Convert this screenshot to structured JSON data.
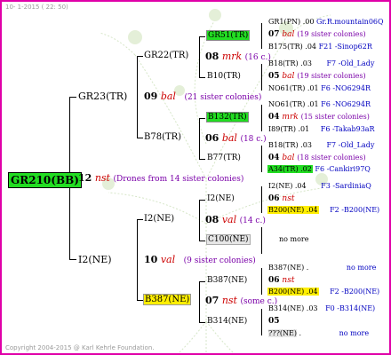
{
  "header": "10-  1-2015 ( 22: 50)",
  "footer": "Copyright 2004-2015 @ Karl Kehrle Foundation.",
  "root": {
    "name": "GR210(BB)",
    "gen": "12",
    "mark": "nst",
    "info": "(Drones from 14 sister colonies)"
  },
  "g1": {
    "top": {
      "name": "GR23(TR)",
      "gen": "09",
      "mark": "bal",
      "info": "(21 sister colonies)"
    },
    "bottom": {
      "name": "I2(NE)",
      "gen": "10",
      "mark": "val",
      "info": "(9 sister colonies)"
    }
  },
  "g2": {
    "a": {
      "name": "GR22(TR)",
      "gen": "08",
      "mark": "mrk",
      "info": "(16 c.)"
    },
    "b": {
      "name": "B78(TR)",
      "gen": "06",
      "mark": "bal",
      "info": "(18 c.)"
    },
    "c": {
      "name": "I2(NE)",
      "gen": "08",
      "mark": "val",
      "info": "(14 c.)"
    },
    "d": {
      "name": "B387(NE)",
      "gen": "07",
      "mark": "nst",
      "info": "(some c.)"
    }
  },
  "g3": {
    "a1": "GR51(TR)",
    "a2": "B10(TR)",
    "b1": "B132(TR)",
    "b2": "B77(TR)",
    "c1": "I2(NE)",
    "c2": "C100(NE)",
    "d1": "B387(NE)",
    "d2": "B314(NE)"
  },
  "g4": {
    "r1": {
      "name": "GR1(PN)",
      "extra": ".00",
      "label": "Gr.R.mountain06Q"
    },
    "r2": {
      "gen": "07",
      "mark": "bal",
      "info": "(19 sister colonies)"
    },
    "r3": {
      "name": "B175(TR)",
      "extra": ".04",
      "label": "F21 -Sinop62R"
    },
    "r4": {
      "name": "B18(TR)",
      "extra": ".03",
      "label": "F7 -Old_Lady"
    },
    "r5": {
      "gen": "05",
      "mark": "bal",
      "info": "(19 sister colonies)"
    },
    "r6": {
      "name": "NO61(TR)",
      "extra": ".01",
      "label": "F6 -NO6294R"
    },
    "r7": {
      "name": "NO61(TR)",
      "extra": ".01",
      "label": "F6 -NO6294R"
    },
    "r8": {
      "gen": "04",
      "mark": "mrk",
      "info": "(15 sister colonies)"
    },
    "r9": {
      "name": "I89(TR)",
      "extra": ".01",
      "label": "F6 -Takab93aR"
    },
    "r10": {
      "name": "B18(TR)",
      "extra": ".03",
      "label": "F7 -Old_Lady"
    },
    "r11": {
      "gen": "04",
      "mark": "bal",
      "info": "(18 sister colonies)"
    },
    "r12": {
      "name": "A34(TR)",
      "extra": ".02",
      "label": "F6 -Cankiri97Q"
    },
    "r13": {
      "name": "I2(NE)",
      "extra": ".04",
      "label": "F3 -SardiniaQ"
    },
    "r14": {
      "gen": "06",
      "mark": "nst"
    },
    "r15": {
      "name": "B200(NE)",
      "extra": ".04",
      "label": "F2 -B200(NE)"
    },
    "r16": {
      "label": "no more"
    },
    "r17": {
      "name": "B387(NE)",
      "extra": ".",
      "label": "no more"
    },
    "r18": {
      "gen": "06",
      "mark": "nst"
    },
    "r19": {
      "name": "B200(NE)",
      "extra": ".04",
      "label": "F2 -B200(NE)"
    },
    "r20": {
      "name": "B314(NE)",
      "extra": ".03",
      "label": "F0 -B314(NE)"
    },
    "r21": {
      "gen": "05"
    },
    "r22": {
      "name": "???(NE)",
      "extra": ".",
      "label": "no more"
    }
  },
  "colors": {
    "border": "#e000a8",
    "highlight_green": "#22dd22",
    "highlight_yellow": "#ffee00",
    "mark_red": "#cc0000",
    "info_purple": "#7a00a8",
    "label_blue": "#0000c0"
  }
}
